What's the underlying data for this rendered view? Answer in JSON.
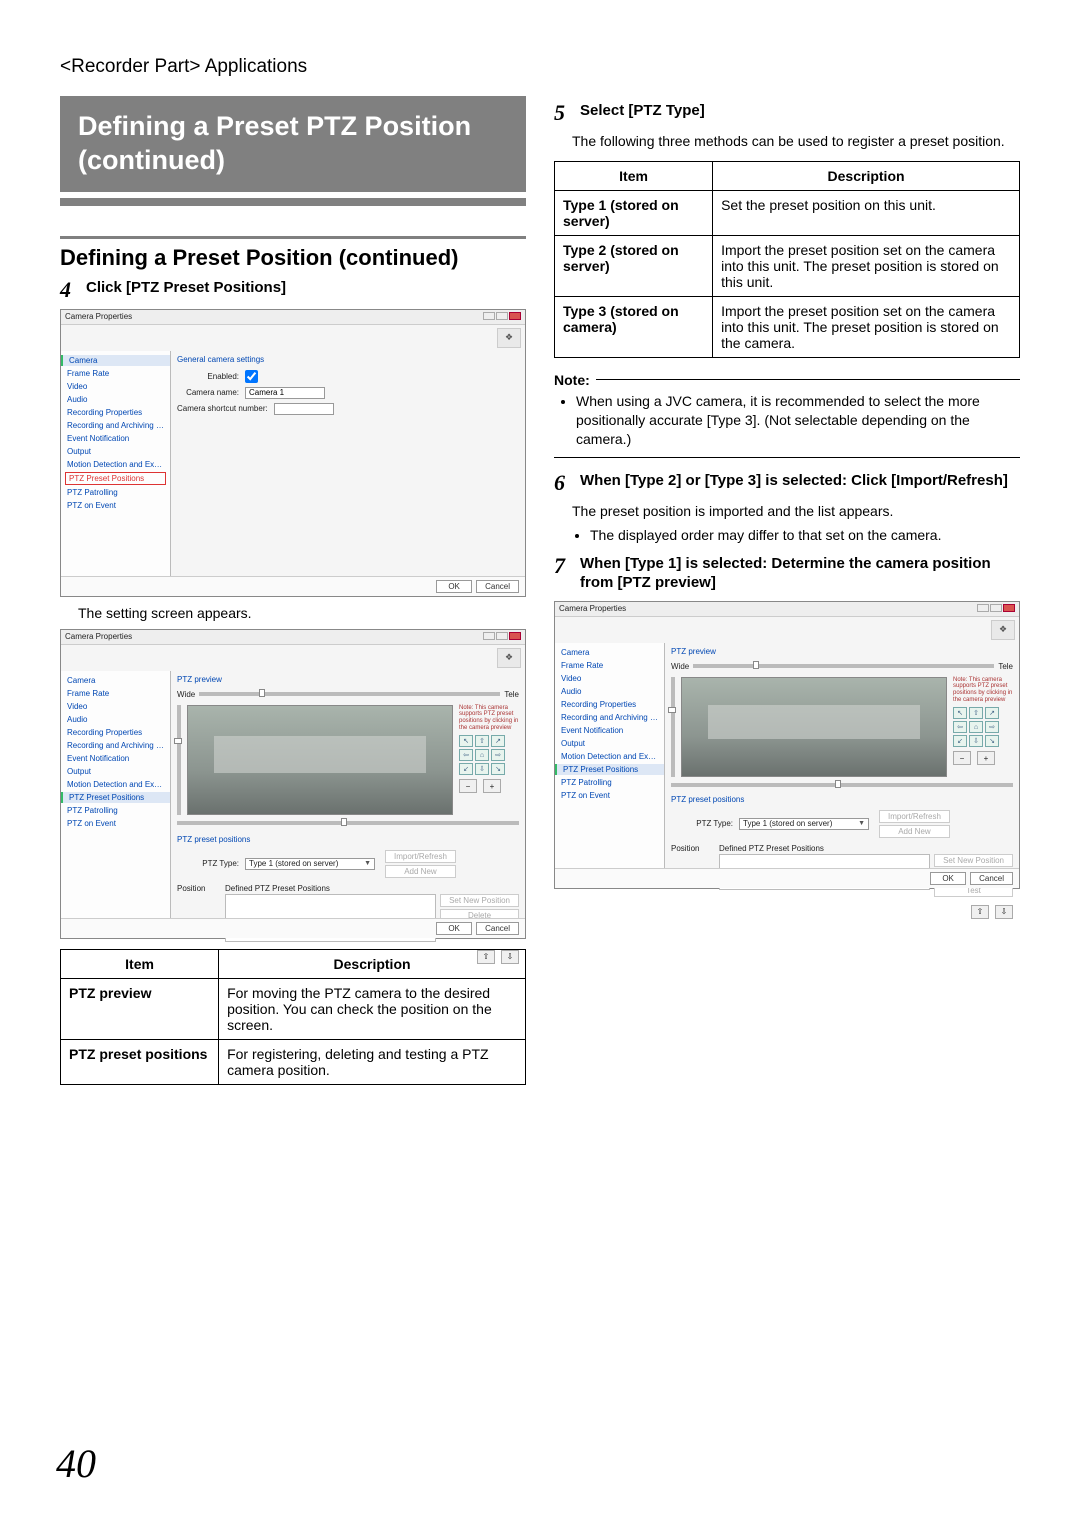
{
  "breadcrumb": "<Recorder Part> Applications",
  "page_number": "40",
  "banner_title": "Defining a Preset PTZ Position (continued)",
  "section_title": "Defining a Preset Position (continued)",
  "steps": {
    "s4": {
      "num": "4",
      "title": "Click [PTZ Preset Positions]"
    },
    "s5": {
      "num": "5",
      "title": "Select [PTZ Type]"
    },
    "s6": {
      "num": "6",
      "title": "When [Type 2] or [Type 3] is selected: Click [Import/Refresh]"
    },
    "s7": {
      "num": "7",
      "title": "When [Type 1] is selected: Determine the camera position from [PTZ preview]"
    }
  },
  "caption_setting_screen": "The setting screen appears.",
  "s5_intro": "The following three methods can be used to register a preset position.",
  "s6_intro": "The preset position is imported and the list appears.",
  "s6_bullet": "The displayed order may differ to that set on the camera.",
  "note_label": "Note:",
  "note_bullet": "When using a JVC camera, it is recommended to select the more positionally accurate [Type 3]. (Not selectable depending on the camera.)",
  "table1": {
    "headers": {
      "c1": "Item",
      "c2": "Description"
    },
    "rows": [
      {
        "item": "PTZ preview",
        "desc": "For moving the PTZ camera to the desired position. You can check the position on the screen."
      },
      {
        "item": "PTZ preset positions",
        "desc": "For registering, deleting and testing a PTZ camera position."
      }
    ]
  },
  "table2": {
    "headers": {
      "c1": "Item",
      "c2": "Description"
    },
    "rows": [
      {
        "item": "Type 1 (stored on server)",
        "desc": "Set the preset position on this unit."
      },
      {
        "item": "Type 2 (stored on server)",
        "desc": "Import the preset position set on the camera into this unit. The preset position is stored on this unit."
      },
      {
        "item": "Type 3 (stored on camera)",
        "desc": "Import the preset position set on the camera into this unit. The preset position is stored on the camera."
      }
    ]
  },
  "mock": {
    "window_title": "Camera Properties",
    "logo": "❖",
    "side_items": [
      "Camera",
      "Frame Rate",
      "Video",
      "Audio",
      "Recording Properties",
      "Recording and Archiving Paths",
      "Event Notification",
      "Output",
      "Motion Detection and Exclude Regions",
      "PTZ Preset Positions",
      "PTZ Patrolling",
      "PTZ on Event"
    ],
    "general_head": "General camera settings",
    "enabled_label": "Enabled:",
    "camera_name_label": "Camera name:",
    "camera_name_value": "Camera 1",
    "shortcut_label": "Camera shortcut number:",
    "btn_ok": "OK",
    "btn_cancel": "Cancel",
    "preview_head": "PTZ preview",
    "wide": "Wide",
    "tele": "Tele",
    "preview_note": "Note: This camera supports PTZ preset positions by clicking in the camera preview",
    "presets_head": "PTZ preset positions",
    "ptz_type_label": "PTZ Type:",
    "ptz_type_value": "Type 1 (stored on server)",
    "btn_import": "Import/Refresh",
    "btn_addnew": "Add New",
    "list_headers": {
      "pos": "Position",
      "def": "Defined PTZ Preset Positions"
    },
    "btn_setnew": "Set New Position",
    "btn_delete": "Delete",
    "btn_test": "Test",
    "caret": "▼",
    "arrows": {
      "up": "⇧",
      "down": "⇩",
      "left": "⇦",
      "right": "⇨",
      "home": "⌂",
      "in": "+",
      "out": "−"
    }
  }
}
